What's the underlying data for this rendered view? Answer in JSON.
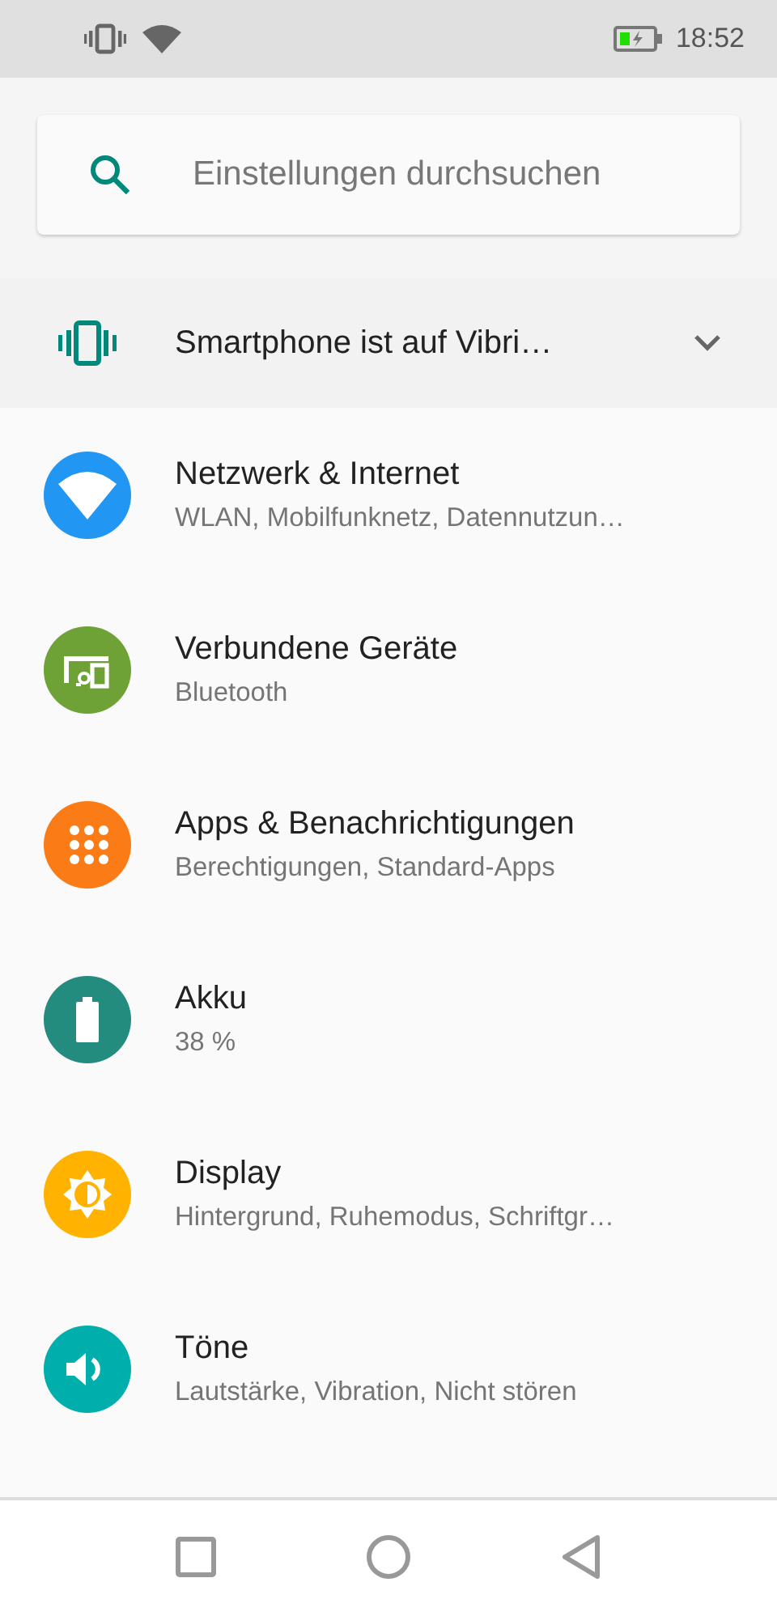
{
  "status_bar": {
    "time": "18:52"
  },
  "search": {
    "placeholder": "Einstellungen durchsuchen"
  },
  "condition": {
    "title": "Smartphone ist auf Vibri…",
    "expanded": false
  },
  "settings": [
    {
      "kind": "wifi",
      "color": "#2196f3",
      "title": "Netzwerk & Internet",
      "summary": "WLAN, Mobilfunknetz, Datennutzun…"
    },
    {
      "kind": "devices",
      "color": "#6ea136",
      "title": "Verbundene Geräte",
      "summary": "Bluetooth"
    },
    {
      "kind": "apps",
      "color": "#fb7c17",
      "title": "Apps & Benachrichtigungen",
      "summary": "Berechtigungen, Standard-Apps"
    },
    {
      "kind": "battery",
      "color": "#248b7f",
      "title": "Akku",
      "summary": "38 %"
    },
    {
      "kind": "display",
      "color": "#ffb300",
      "title": "Display",
      "summary": "Hintergrund, Ruhemodus, Schriftgr…"
    },
    {
      "kind": "sound",
      "color": "#00aeac",
      "title": "Töne",
      "summary": "Lautstärke, Vibration, Nicht stören"
    }
  ]
}
